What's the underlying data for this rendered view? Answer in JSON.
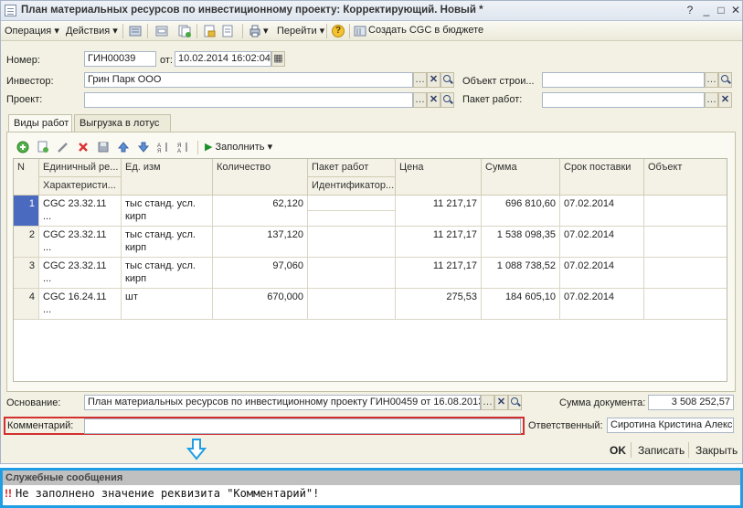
{
  "window": {
    "title": "План материальных ресурсов по инвестиционному проекту: Корректирующий. Новый *",
    "controls": {
      "help": "?",
      "minimize": "_",
      "maximize": "□",
      "close": "✕"
    }
  },
  "toolbar": {
    "operation": "Операция",
    "actions": "Действия",
    "goto": "Перейти",
    "create_cgc": "Создать CGC в бюджете",
    "help_icon": "?"
  },
  "form": {
    "number_label": "Номер:",
    "number_value": "ГИН00039",
    "date_label": "от:",
    "date_value": "10.02.2014 16:02:04",
    "investor_label": "Инвестор:",
    "investor_value": "Грин Парк ООО",
    "object_label": "Объект строи...",
    "object_value": "",
    "project_label": "Проект:",
    "project_value": "",
    "workpack_label": "Пакет работ:",
    "workpack_value": ""
  },
  "tabs": [
    {
      "label": "Виды работ"
    },
    {
      "label": "Выгрузка в лотус"
    }
  ],
  "grid_toolbar": {
    "fill": "Заполнить"
  },
  "table": {
    "headers": {
      "n": "N",
      "unit_price": "Единичный ре...",
      "characteristic": "Характеристи...",
      "uom": "Ед. изм",
      "quantity": "Количество",
      "work_package": "Пакет работ",
      "identifier": "Идентификатор...",
      "price": "Цена",
      "sum": "Сумма",
      "delivery": "Срок поставки",
      "object": "Объект"
    },
    "rows": [
      {
        "n": "1",
        "code": "CGC 23.32.11 ...",
        "uom": "тыс станд. усл. кирп",
        "qty": "62,120",
        "price": "11 217,17",
        "sum": "696 810,60",
        "date": "07.02.2014"
      },
      {
        "n": "2",
        "code": "CGC 23.32.11 ...",
        "uom": "тыс станд. усл. кирп",
        "qty": "137,120",
        "price": "11 217,17",
        "sum": "1 538 098,35",
        "date": "07.02.2014"
      },
      {
        "n": "3",
        "code": "CGC 23.32.11 ...",
        "uom": "тыс станд. усл. кирп",
        "qty": "97,060",
        "price": "11 217,17",
        "sum": "1 088 738,52",
        "date": "07.02.2014"
      },
      {
        "n": "4",
        "code": "CGC 16.24.11 ...",
        "uom": "шт",
        "qty": "670,000",
        "price": "275,53",
        "sum": "184 605,10",
        "date": "07.02.2014"
      }
    ]
  },
  "footer": {
    "basis_label": "Основание:",
    "basis_value": "План материальных ресурсов по инвестиционному проекту ГИН00459 от 16.08.2013",
    "total_label": "Сумма документа:",
    "total_value": "3 508 252,57",
    "comment_label": "Комментарий:",
    "comment_value": "",
    "responsible_label": "Ответственный:",
    "responsible_value": "Сиротина Кристина Алекс",
    "ok": "OK",
    "save": "Записать",
    "close": "Закрыть"
  },
  "messages": {
    "title": "Служебные сообщения",
    "icon": "!!",
    "line": "Не заполнено значение реквизита \"Комментарий\"!"
  },
  "colors": {
    "accent": "#1f9ee6",
    "error": "#d23030",
    "selected": "#4a6ac0"
  }
}
